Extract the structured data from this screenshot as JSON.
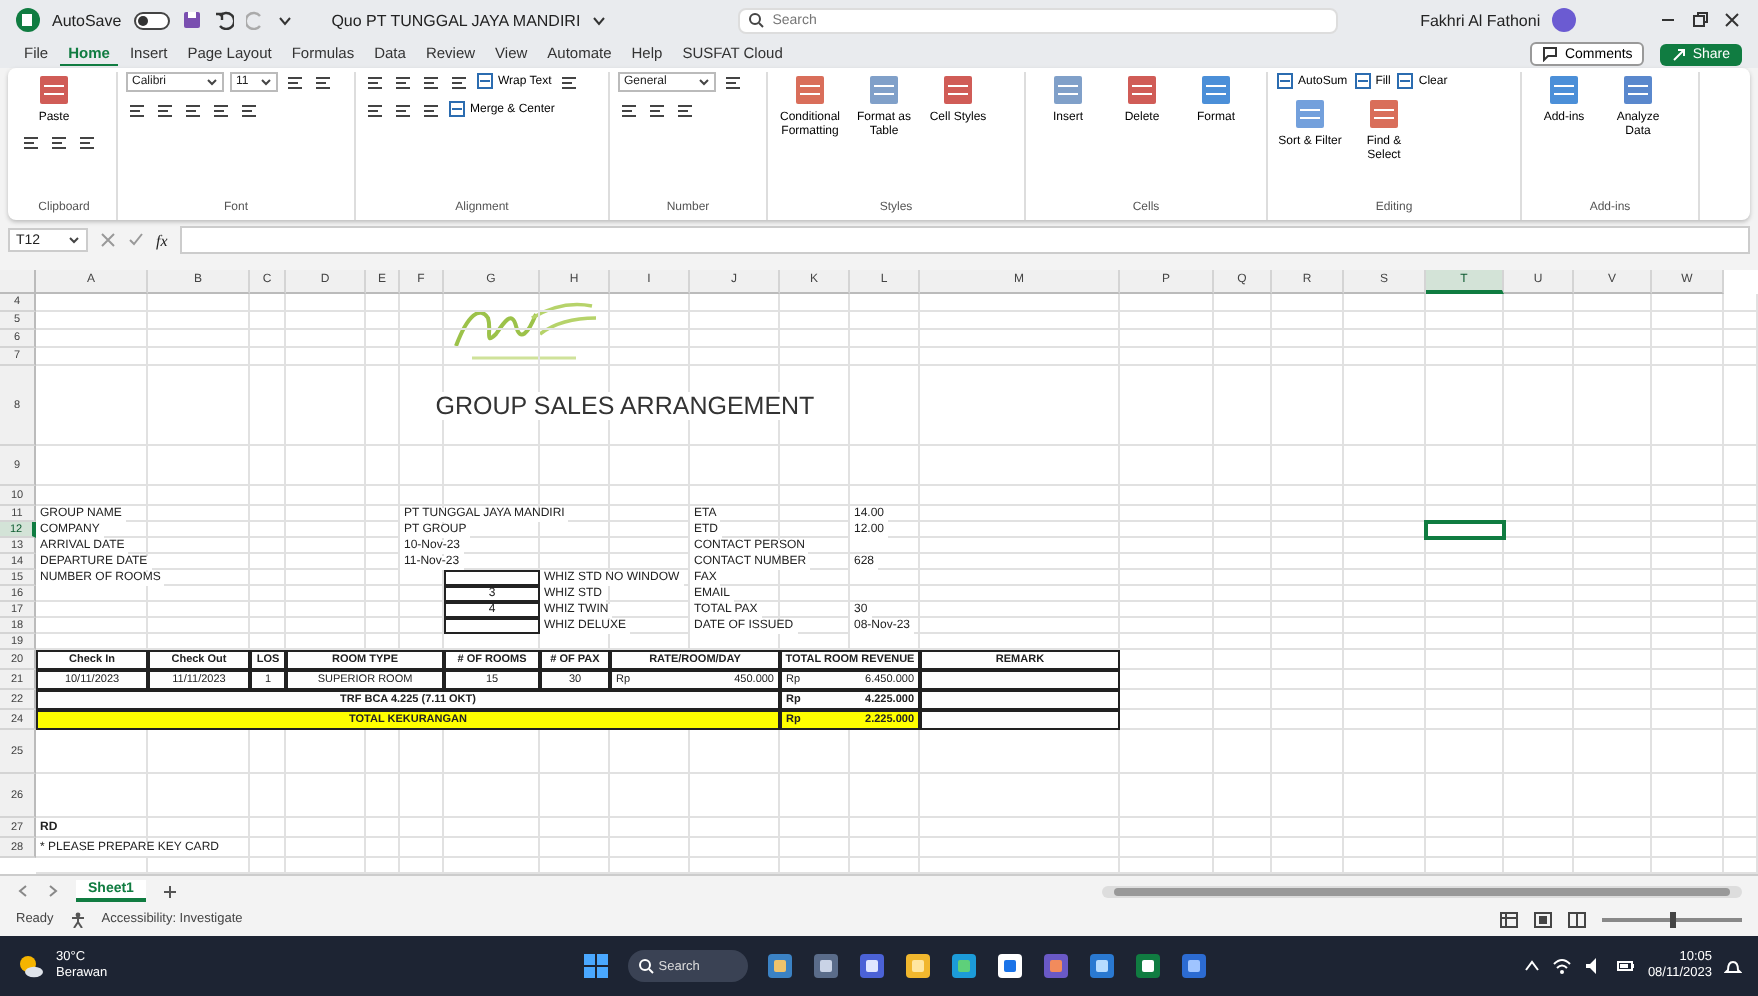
{
  "title_bar": {
    "autosave": {
      "label": "AutoSave",
      "on": false
    },
    "document_title": "Quo PT TUNGGAL JAYA MANDIRI",
    "search": {
      "placeholder": "Search"
    },
    "user": "Fakhri Al Fathoni"
  },
  "menu_tabs": [
    {
      "label": "File",
      "selected": false
    },
    {
      "label": "Home",
      "selected": true
    },
    {
      "label": "Insert",
      "selected": false
    },
    {
      "label": "Page Layout",
      "selected": false
    },
    {
      "label": "Formulas",
      "selected": false
    },
    {
      "label": "Data",
      "selected": false
    },
    {
      "label": "Review",
      "selected": false
    },
    {
      "label": "View",
      "selected": false
    },
    {
      "label": "Automate",
      "selected": false
    },
    {
      "label": "Help",
      "selected": false
    },
    {
      "label": "SUSFAT Cloud",
      "selected": false
    }
  ],
  "comments": "Comments",
  "share": "Share",
  "ribbon": [
    {
      "label": "Clipboard",
      "items": [
        {
          "kind": "large",
          "label": "Paste"
        },
        {
          "kind": "tool"
        },
        {
          "kind": "tool"
        },
        {
          "kind": "tool"
        }
      ]
    },
    {
      "label": "Font",
      "items": [
        {
          "kind": "combo",
          "label": "Calibri"
        },
        {
          "kind": "combo",
          "label": "11"
        },
        {
          "kind": "tool"
        },
        {
          "kind": "tool"
        },
        {
          "kind": "tool"
        },
        {
          "kind": "tool"
        },
        {
          "kind": "tool"
        },
        {
          "kind": "tool"
        },
        {
          "kind": "tool"
        }
      ]
    },
    {
      "label": "Alignment",
      "items": [
        {
          "kind": "tool"
        },
        {
          "kind": "tool"
        },
        {
          "kind": "tool"
        },
        {
          "kind": "tool"
        },
        {
          "kind": "small",
          "label": "Wrap Text"
        },
        {
          "kind": "tool"
        },
        {
          "kind": "tool"
        },
        {
          "kind": "tool"
        },
        {
          "kind": "tool"
        },
        {
          "kind": "small",
          "label": "Merge & Center"
        }
      ]
    },
    {
      "label": "Number",
      "items": [
        {
          "kind": "combo",
          "label": "General"
        },
        {
          "kind": "tool"
        },
        {
          "kind": "tool"
        },
        {
          "kind": "tool"
        },
        {
          "kind": "tool"
        }
      ]
    },
    {
      "label": "Styles",
      "items": [
        {
          "kind": "large",
          "label": "Conditional Formatting"
        },
        {
          "kind": "large",
          "label": "Format as Table"
        },
        {
          "kind": "large",
          "label": "Cell Styles"
        }
      ]
    },
    {
      "label": "Cells",
      "items": [
        {
          "kind": "large",
          "label": "Insert"
        },
        {
          "kind": "large",
          "label": "Delete"
        },
        {
          "kind": "large",
          "label": "Format"
        }
      ]
    },
    {
      "label": "Editing",
      "items": [
        {
          "kind": "small",
          "label": "AutoSum"
        },
        {
          "kind": "small",
          "label": "Fill"
        },
        {
          "kind": "small",
          "label": "Clear"
        },
        {
          "kind": "large",
          "label": "Sort & Filter"
        },
        {
          "kind": "large",
          "label": "Find & Select"
        }
      ]
    },
    {
      "label": "Add-ins",
      "items": [
        {
          "kind": "large",
          "label": "Add-ins"
        },
        {
          "kind": "large",
          "label": "Analyze Data"
        }
      ]
    }
  ],
  "formula_bar": {
    "name_box": "T12",
    "function_label": "fx"
  },
  "sheet": {
    "columns": [
      {
        "label": "A",
        "selected": false
      },
      {
        "label": "B",
        "selected": false
      },
      {
        "label": "C",
        "selected": false
      },
      {
        "label": "D",
        "selected": false
      },
      {
        "label": "E",
        "selected": false
      },
      {
        "label": "F",
        "selected": false
      },
      {
        "label": "G",
        "selected": false
      },
      {
        "label": "H",
        "selected": false
      },
      {
        "label": "I",
        "selected": false
      },
      {
        "label": "J",
        "selected": false
      },
      {
        "label": "K",
        "selected": false
      },
      {
        "label": "L",
        "selected": false
      },
      {
        "label": "M",
        "selected": false
      },
      {
        "label": "P",
        "selected": false
      },
      {
        "label": "Q",
        "selected": false
      },
      {
        "label": "R",
        "selected": false
      },
      {
        "label": "S",
        "selected": false
      },
      {
        "label": "T",
        "selected": true
      },
      {
        "label": "U",
        "selected": false
      },
      {
        "label": "V",
        "selected": false
      },
      {
        "label": "W",
        "selected": false
      }
    ],
    "rows": [
      {
        "label": "4",
        "selected": false
      },
      {
        "label": "5",
        "selected": false
      },
      {
        "label": "6",
        "selected": false
      },
      {
        "label": "7",
        "selected": false
      },
      {
        "label": "8",
        "selected": false
      },
      {
        "label": "9",
        "selected": false
      },
      {
        "label": "10",
        "selected": false
      },
      {
        "label": "11",
        "selected": false
      },
      {
        "label": "12",
        "selected": true
      },
      {
        "label": "13",
        "selected": false
      },
      {
        "label": "14",
        "selected": false
      },
      {
        "label": "15",
        "selected": false
      },
      {
        "label": "16",
        "selected": false
      },
      {
        "label": "17",
        "selected": false
      },
      {
        "label": "18",
        "selected": false
      },
      {
        "label": "19",
        "selected": false
      },
      {
        "label": "20",
        "selected": false
      },
      {
        "label": "21",
        "selected": false
      },
      {
        "label": "22",
        "selected": false
      },
      {
        "label": "24",
        "selected": false
      },
      {
        "label": "25",
        "selected": false
      },
      {
        "label": "26",
        "selected": false
      },
      {
        "label": "27",
        "selected": false
      },
      {
        "label": "28",
        "selected": false
      }
    ],
    "heading": "GROUP SALES ARRANGEMENT",
    "info_left": [
      {
        "label": "GROUP NAME",
        "value": "PT TUNGGAL JAYA MANDIRI"
      },
      {
        "label": "COMPANY",
        "value": "PT GROUP"
      },
      {
        "label": "ARRIVAL DATE",
        "value": "10-Nov-23"
      },
      {
        "label": "DEPARTURE DATE",
        "value": "11-Nov-23"
      },
      {
        "label": "NUMBER OF ROOMS"
      }
    ],
    "room_types": [
      {
        "type": "WHIZ STD NO WINDOW"
      },
      {
        "count": "3",
        "type": "WHIZ STD"
      },
      {
        "count": "4",
        "type": "WHIZ TWIN"
      },
      {
        "type": "WHIZ DELUXE"
      }
    ],
    "info_right": [
      {
        "label": "ETA",
        "value": "14.00"
      },
      {
        "label": "ETD",
        "value": "12.00"
      },
      {
        "label": "CONTACT PERSON"
      },
      {
        "label": "CONTACT NUMBER",
        "value": "628"
      },
      {
        "label": "FAX"
      },
      {
        "label": "EMAIL"
      },
      {
        "label": "TOTAL PAX",
        "value": "30"
      },
      {
        "label": "DATE OF ISSUED",
        "value": "08-Nov-23"
      }
    ],
    "booking_table": {
      "columns": [
        "Check In",
        "Check Out",
        "LOS",
        "ROOM TYPE",
        "# OF ROOMS",
        "# OF PAX",
        "RATE/ROOM/DAY",
        "TOTAL ROOM REVENUE",
        "REMARK"
      ],
      "rows": [
        [
          "10/11/2023",
          "11/11/2023",
          "1",
          "SUPERIOR ROOM",
          "15",
          "30",
          {
            "currency": "Rp",
            "amount": "450.000"
          },
          {
            "currency": "Rp",
            "amount": "6.450.000"
          }
        ]
      ]
    },
    "summary_rows": [
      {
        "label": "TRF BCA 4.225 (7.11 OKT)",
        "currency": "Rp",
        "amount": "4.225.000",
        "highlighted": false
      },
      {
        "label": "TOTAL KEKURANGAN",
        "currency": "Rp",
        "amount": "2.225.000",
        "highlighted": true
      }
    ],
    "notes": [
      "RD",
      "* PLEASE PREPARE KEY CARD"
    ]
  },
  "sheet_tabs": [
    {
      "label": "Sheet1",
      "selected": true
    }
  ],
  "status_bar": {
    "mode": "Ready",
    "accessibility": "Accessibility: Investigate",
    "zoom": {
      "level": 0.5
    }
  },
  "taskbar": {
    "weather": {
      "temperature": "30°C",
      "condition": "Berawan"
    },
    "search": {
      "placeholder": "Search"
    },
    "time": "10:05",
    "date": "08/11/2023"
  }
}
